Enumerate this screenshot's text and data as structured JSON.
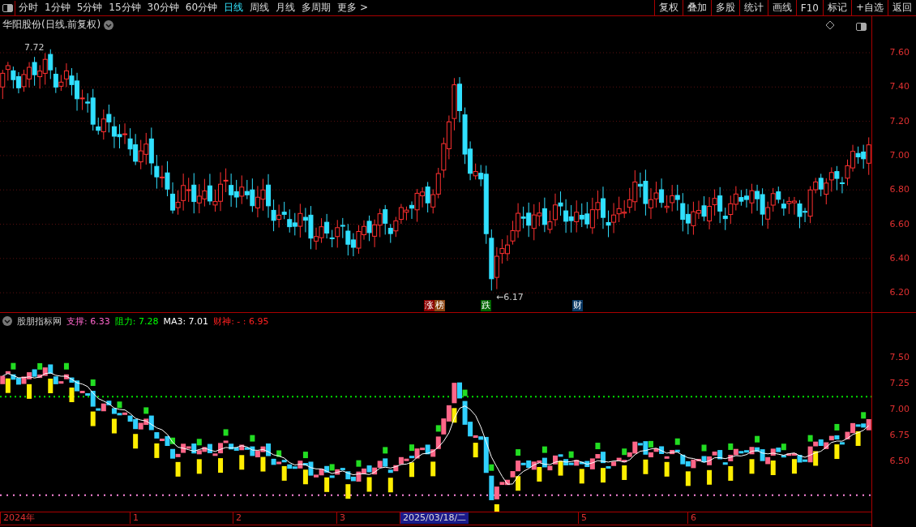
{
  "toolbar": {
    "periods": [
      {
        "label": "分时",
        "selected": false
      },
      {
        "label": "1分钟",
        "selected": false
      },
      {
        "label": "5分钟",
        "selected": false
      },
      {
        "label": "15分钟",
        "selected": false
      },
      {
        "label": "30分钟",
        "selected": false
      },
      {
        "label": "60分钟",
        "selected": false
      },
      {
        "label": "日线",
        "selected": true
      },
      {
        "label": "周线",
        "selected": false
      },
      {
        "label": "月线",
        "selected": false
      },
      {
        "label": "多周期",
        "selected": false
      },
      {
        "label": "更多 >",
        "selected": false
      }
    ],
    "actions": [
      "复权",
      "叠加",
      "多股",
      "统计",
      "画线",
      "F10",
      "标记",
      "+自选",
      "返回"
    ]
  },
  "main_chart": {
    "title": "华阳股份(日线.前复权)",
    "high_label": "7.72",
    "low_label": "←6.17",
    "price_ticks": [
      "7.60",
      "7.40",
      "7.20",
      "7.00",
      "6.80",
      "6.60",
      "6.40",
      "6.20"
    ],
    "markers": [
      {
        "text": "涨",
        "color": "#8b0000"
      },
      {
        "text": "榜",
        "color": "#8b4513"
      },
      {
        "text": "跌",
        "color": "#006400"
      },
      {
        "text": "财",
        "color": "#0a3a66"
      }
    ]
  },
  "indicator": {
    "name": "股朋指标网",
    "values": [
      {
        "label": "支撑:",
        "value": "6.33",
        "color": "#ff66cc"
      },
      {
        "label": "阻力:",
        "value": "7.28",
        "color": "#00ff00"
      },
      {
        "label": "MA3:",
        "value": "7.01",
        "color": "#ffffff"
      },
      {
        "label": "财神:",
        "value": "- : 6.95",
        "color": "#ff2020"
      }
    ],
    "price_ticks": [
      "7.50",
      "7.25",
      "7.00",
      "6.75",
      "6.50"
    ]
  },
  "date_axis": [
    {
      "label": "2024年",
      "selected": false
    },
    {
      "label": "1",
      "selected": false
    },
    {
      "label": "2",
      "selected": false
    },
    {
      "label": "3",
      "selected": false
    },
    {
      "label": "2025/03/18/二",
      "selected": true
    },
    {
      "label": "5",
      "selected": false
    },
    {
      "label": "6",
      "selected": false
    }
  ]
}
